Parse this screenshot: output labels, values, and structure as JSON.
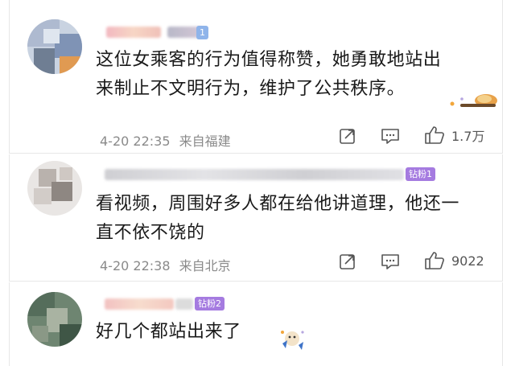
{
  "comments": [
    {
      "text_line1": "这位女乘客的行为值得称赞，她勇敢地站出",
      "text_line2": "来制止不文明行为，维护了公共秩序。",
      "timestamp": "4-20 22:35",
      "location": "来自福建",
      "likes": "1.7万",
      "badge": "1"
    },
    {
      "text_line1": "看视频，周围好多人都在给他讲道理，他还一",
      "text_line2": "直不依不饶的",
      "timestamp": "4-20 22:38",
      "location": "来自北京",
      "likes": "9022",
      "badge": "钻粉1"
    },
    {
      "text_line1": "好几个都站出来了",
      "badge": "钻粉2"
    }
  ],
  "icons": {
    "share": "share-icon",
    "comment": "comment-icon",
    "like": "thumbs-up-icon"
  },
  "colors": {
    "text": "#1a1a1a",
    "meta": "#8a8a8a",
    "badge_purple": "#a57be0",
    "badge_blue": "#8fb4ea"
  }
}
